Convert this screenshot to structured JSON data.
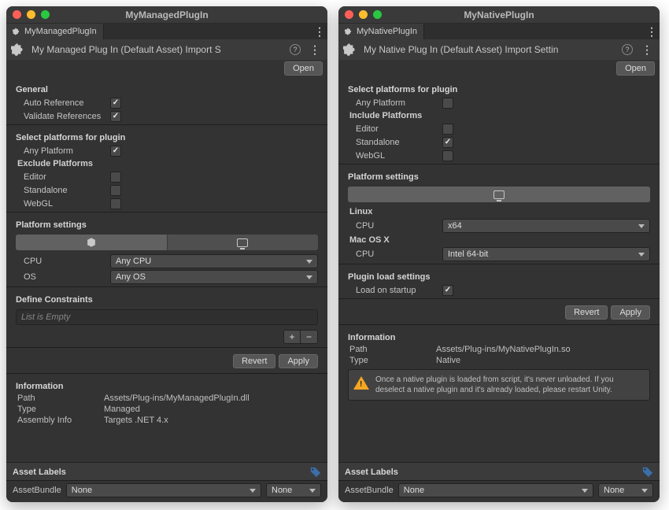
{
  "left": {
    "windowTitle": "MyManagedPlugIn",
    "tabTitle": "MyManagedPlugIn",
    "headerTitle": "My Managed Plug In (Default Asset) Import S",
    "openBtn": "Open",
    "general": {
      "header": "General",
      "autoRef": "Auto Reference",
      "validateRef": "Validate References"
    },
    "selectPlatforms": {
      "header": "Select platforms for plugin",
      "anyPlatform": "Any Platform",
      "exclude": "Exclude Platforms",
      "editor": "Editor",
      "standalone": "Standalone",
      "webgl": "WebGL"
    },
    "platformSettings": {
      "header": "Platform settings",
      "cpu": "CPU",
      "cpuVal": "Any CPU",
      "os": "OS",
      "osVal": "Any OS"
    },
    "defineConstraints": {
      "header": "Define Constraints",
      "empty": "List is Empty"
    },
    "revert": "Revert",
    "apply": "Apply",
    "info": {
      "header": "Information",
      "pathK": "Path",
      "pathV": "Assets/Plug-ins/MyManagedPlugIn.dll",
      "typeK": "Type",
      "typeV": "Managed",
      "asmK": "Assembly Info",
      "asmV": "Targets .NET 4.x"
    },
    "assetLabels": "Asset Labels",
    "assetBundle": "AssetBundle",
    "none": "None"
  },
  "right": {
    "windowTitle": "MyNativePlugIn",
    "tabTitle": "MyNativePlugIn",
    "headerTitle": "My Native Plug In (Default Asset) Import Settin",
    "openBtn": "Open",
    "selectPlatforms": {
      "header": "Select platforms for plugin",
      "anyPlatform": "Any Platform",
      "include": "Include Platforms",
      "editor": "Editor",
      "standalone": "Standalone",
      "webgl": "WebGL"
    },
    "platformSettings": {
      "header": "Platform settings",
      "linux": "Linux",
      "linuxCpu": "CPU",
      "linuxCpuVal": "x64",
      "mac": "Mac OS X",
      "macCpu": "CPU",
      "macCpuVal": "Intel 64-bit"
    },
    "loadSettings": {
      "header": "Plugin load settings",
      "loadOnStartup": "Load on startup"
    },
    "revert": "Revert",
    "apply": "Apply",
    "info": {
      "header": "Information",
      "pathK": "Path",
      "pathV": "Assets/Plug-ins/MyNativePlugIn.so",
      "typeK": "Type",
      "typeV": "Native"
    },
    "warning": "Once a native plugin is loaded from script, it's never unloaded. If you deselect a native plugin and it's already loaded, please restart Unity.",
    "assetLabels": "Asset Labels",
    "assetBundle": "AssetBundle",
    "none": "None"
  }
}
